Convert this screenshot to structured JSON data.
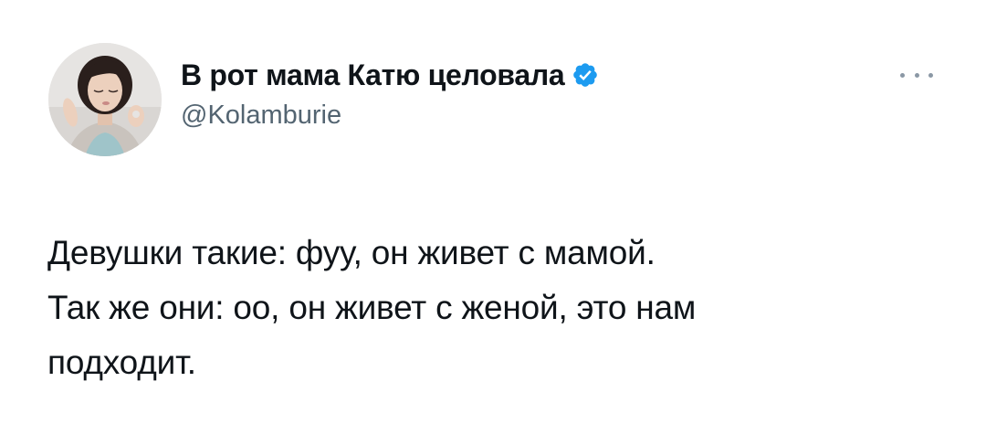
{
  "author": {
    "display_name": "В рот мама Катю целовала",
    "handle": "@Kolamburie",
    "verified": true,
    "verified_color": "#1d9bf0"
  },
  "menu": {
    "icon": "more-horizontal-icon"
  },
  "tweet": {
    "lines": [
      "Девушки такие: фуу, он живет с мамой.",
      "Так же они: оо, он живет с женой, это нам",
      "подходит."
    ]
  }
}
